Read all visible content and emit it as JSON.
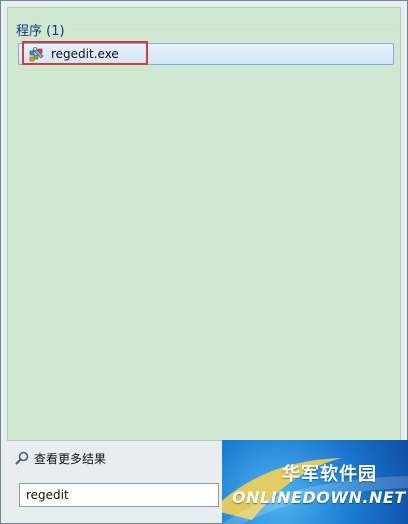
{
  "results": {
    "group_title": "程序 (1)",
    "items": [
      {
        "label": "regedit.exe",
        "icon": "registry-editor-icon"
      }
    ]
  },
  "see_more": {
    "label": "查看更多结果",
    "icon": "search-icon"
  },
  "search": {
    "value": "regedit"
  },
  "watermark": {
    "brand_cn": "华军软件园",
    "brand_en": "ONLINEDOWN.NET"
  },
  "colors": {
    "results_bg": "#cfe8cf",
    "group_title": "#1e3287",
    "highlight_outline": "#d63b3b",
    "selection": "#d3e5f8"
  }
}
